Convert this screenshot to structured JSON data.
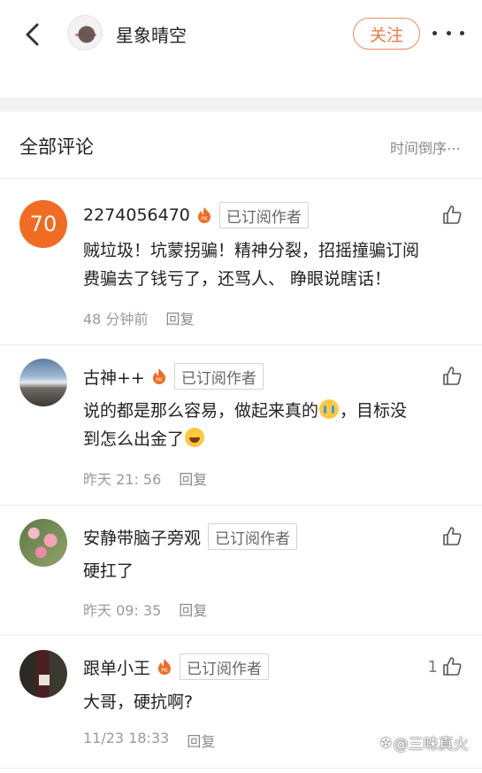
{
  "header": {
    "user_name": "星象晴空",
    "follow_label": "关注"
  },
  "section": {
    "title": "全部评论",
    "sort_label": "时间倒序⋯"
  },
  "comments": [
    {
      "avatar_text": "70",
      "name": "2274056470",
      "badge": "已订阅作者",
      "text_1": "贼垃圾！坑蒙拐骗！精神分裂，招摇撞骗订阅",
      "text_2": "费骗去了钱亏了，还骂人、 睁眼说瞎话！",
      "time": "48 分钟前",
      "reply": "回复",
      "likes": ""
    },
    {
      "name": "古神++",
      "badge": "已订阅作者",
      "text_1a": "说的都是那么容易，做起来真的",
      "text_1b": "，目标没",
      "text_2": "到怎么出金了",
      "time": "昨天 21: 56",
      "reply": "回复",
      "likes": ""
    },
    {
      "name": "安静带脑子旁观",
      "badge": "已订阅作者",
      "text_1": "硬扛了",
      "time": "昨天 09: 35",
      "reply": "回复",
      "likes": ""
    },
    {
      "name": "跟单小王",
      "badge": "已订阅作者",
      "text_1": "大哥，硬抗啊?",
      "time": "11/23 18:33",
      "reply": "回复",
      "likes": "1"
    }
  ],
  "watermark": "@三味真火",
  "colors": {
    "accent": "#f07a45",
    "avatar_orange": "#f26b22"
  }
}
